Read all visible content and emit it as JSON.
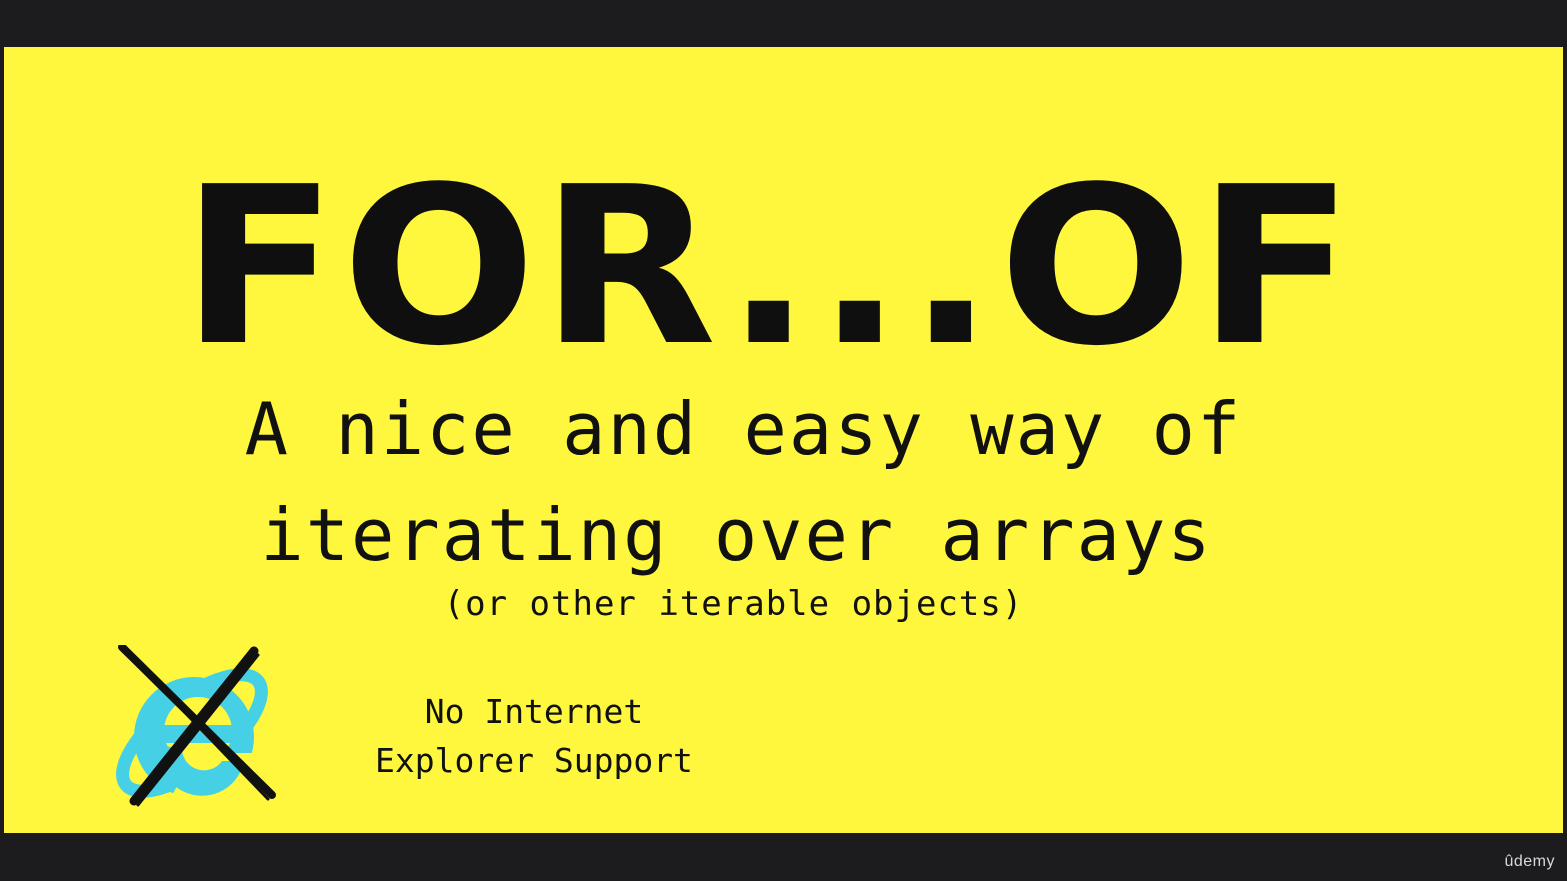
{
  "slide": {
    "title": "FOR...OF",
    "subtitle_line1": "A nice and easy way of",
    "subtitle_line2": "iterating over arrays",
    "subtitle_note": "(or other iterable objects)",
    "ie_note_line1": "No Internet",
    "ie_note_line2": "Explorer Support",
    "ie_logo_icon": "internet-explorer-crossed-out-icon"
  },
  "brand": {
    "name": "ûdemy"
  },
  "colors": {
    "slide_background": "#fef73e",
    "text": "#111111",
    "ie_blue": "#46d0e6",
    "frame": "#1c1c1e"
  }
}
